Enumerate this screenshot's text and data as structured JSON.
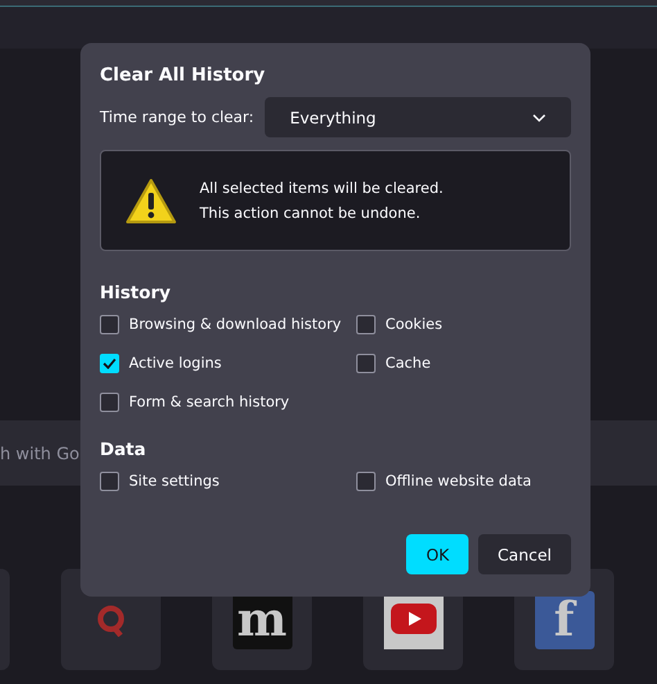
{
  "search": {
    "value": "h with Go"
  },
  "tiles": [
    {
      "kind": "empty"
    },
    {
      "kind": "ring"
    },
    {
      "kind": "letter-dark",
      "text": "m"
    },
    {
      "kind": "play"
    },
    {
      "kind": "letter-blue",
      "text": "f"
    }
  ],
  "dialog": {
    "title": "Clear All History",
    "time_range": {
      "label": "Time range to clear:",
      "value": "Everything"
    },
    "warning": {
      "lines": [
        "All selected items will be cleared.",
        "This action cannot be undone."
      ]
    },
    "sections": [
      {
        "heading": "History",
        "items": [
          {
            "label": "Browsing & download history",
            "checked": false
          },
          {
            "label": "Cookies",
            "checked": false
          },
          {
            "label": "Active logins",
            "checked": true
          },
          {
            "label": "Cache",
            "checked": false
          },
          {
            "label": "Form & search history",
            "checked": false
          }
        ]
      },
      {
        "heading": "Data",
        "items": [
          {
            "label": "Site settings",
            "checked": false
          },
          {
            "label": "Offline website data",
            "checked": false
          }
        ]
      }
    ],
    "buttons": [
      {
        "label": "OK",
        "kind": "primary"
      },
      {
        "label": "Cancel",
        "kind": "secondary"
      }
    ]
  }
}
